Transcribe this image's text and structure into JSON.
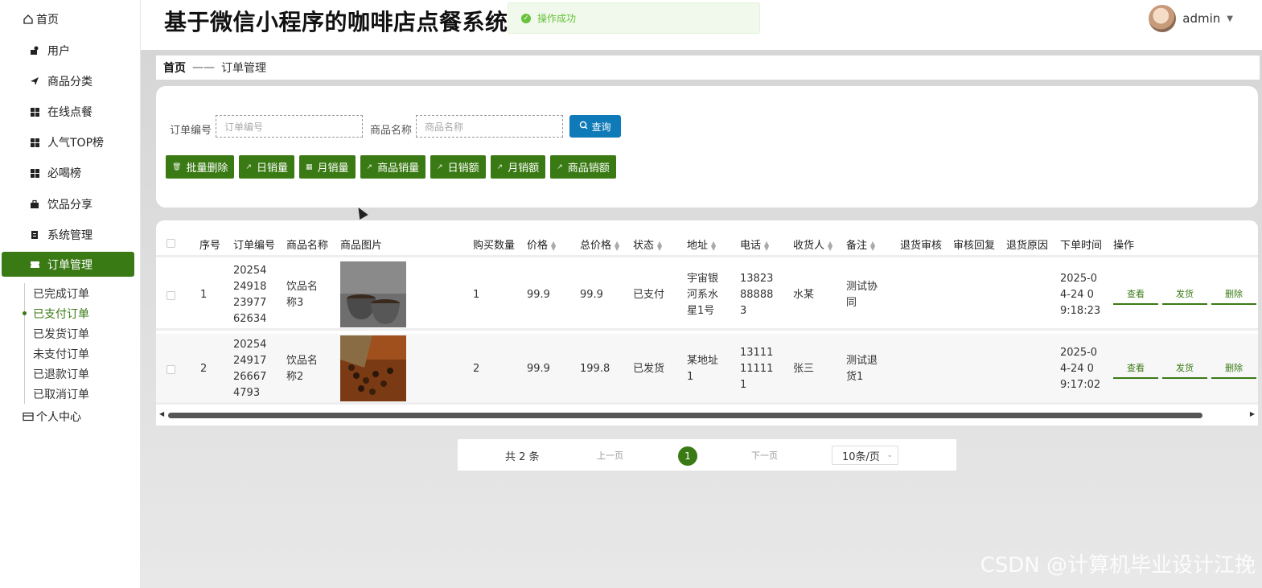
{
  "sidebar": {
    "home": "首页",
    "items": [
      {
        "label": "用户"
      },
      {
        "label": "商品分类"
      },
      {
        "label": "在线点餐"
      },
      {
        "label": "人气TOP榜"
      },
      {
        "label": "必喝榜"
      },
      {
        "label": "饮品分享"
      },
      {
        "label": "系统管理"
      },
      {
        "label": "订单管理"
      }
    ],
    "sub_items": [
      {
        "label": "已完成订单"
      },
      {
        "label": "已支付订单"
      },
      {
        "label": "已发货订单"
      },
      {
        "label": "未支付订单"
      },
      {
        "label": "已退款订单"
      },
      {
        "label": "已取消订单"
      }
    ],
    "personal": "个人中心"
  },
  "header": {
    "title": "基于微信小程序的咖啡店点餐系统",
    "toast": "操作成功",
    "username": "admin"
  },
  "breadcrumb": {
    "home": "首页",
    "sep": "——",
    "current": "订单管理"
  },
  "search": {
    "order_no_label": "订单编号",
    "order_no_placeholder": "订单编号",
    "product_label": "商品名称",
    "product_placeholder": "商品名称",
    "query": "查询"
  },
  "actions": [
    "批量删除",
    "日销量",
    "月销量",
    "商品销量",
    "日销额",
    "月销额",
    "商品销额"
  ],
  "table": {
    "headers": {
      "index": "序号",
      "order_no": "订单编号",
      "product": "商品名称",
      "image": "商品图片",
      "qty": "购买数量",
      "price": "价格",
      "total": "总价格",
      "status": "状态",
      "address": "地址",
      "phone": "电话",
      "receiver": "收货人",
      "note": "备注",
      "refund_review": "退货审核",
      "review_reply": "审核回复",
      "refund_reason": "退货原因",
      "order_time": "下单时间",
      "ops": "操作"
    },
    "rows": [
      {
        "index": "1",
        "order_no": [
          "20254",
          "24918",
          "23977",
          "62634"
        ],
        "product": [
          "饮品名",
          "称3"
        ],
        "qty": "1",
        "price": "99.9",
        "total": "99.9",
        "status": "已支付",
        "address": [
          "宇宙银",
          "河系水",
          "星1号"
        ],
        "phone": [
          "13823",
          "88888",
          "3"
        ],
        "receiver": "水某",
        "note": [
          "测试协",
          "同"
        ],
        "time": [
          "2025-0",
          "4-24 0",
          "9:18:23"
        ]
      },
      {
        "index": "2",
        "order_no": [
          "20254",
          "24917",
          "26667",
          "4793"
        ],
        "product": [
          "饮品名",
          "称2"
        ],
        "qty": "2",
        "price": "99.9",
        "total": "199.8",
        "status": "已发货",
        "address": [
          "某地址",
          "1"
        ],
        "phone": [
          "13111",
          "11111",
          "1"
        ],
        "receiver": "张三",
        "note": [
          "测试退",
          "货1"
        ],
        "time": [
          "2025-0",
          "4-24 0",
          "9:17:02"
        ]
      }
    ],
    "ops": {
      "view": "查看",
      "ship": "发货",
      "delete": "删除"
    }
  },
  "pager": {
    "total": "共 2 条",
    "prev": "上一页",
    "page": "1",
    "next": "下一页",
    "size": "10条/页"
  },
  "watermark": "CSDN @计算机毕业设计江挽",
  "colors": {
    "primary": "#3a7a14",
    "query": "#0f7ab8",
    "toast_bg": "#f0f9eb",
    "toast_text": "#67c23a"
  }
}
